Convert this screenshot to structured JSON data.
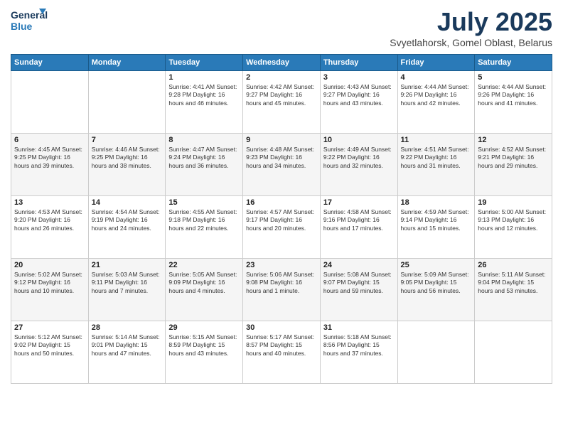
{
  "header": {
    "logo_line1": "General",
    "logo_line2": "Blue",
    "title": "July 2025",
    "subtitle": "Svyetlahorsk, Gomel Oblast, Belarus"
  },
  "weekdays": [
    "Sunday",
    "Monday",
    "Tuesday",
    "Wednesday",
    "Thursday",
    "Friday",
    "Saturday"
  ],
  "weeks": [
    [
      {
        "day": "",
        "info": ""
      },
      {
        "day": "",
        "info": ""
      },
      {
        "day": "1",
        "info": "Sunrise: 4:41 AM\nSunset: 9:28 PM\nDaylight: 16 hours and 46 minutes."
      },
      {
        "day": "2",
        "info": "Sunrise: 4:42 AM\nSunset: 9:27 PM\nDaylight: 16 hours and 45 minutes."
      },
      {
        "day": "3",
        "info": "Sunrise: 4:43 AM\nSunset: 9:27 PM\nDaylight: 16 hours and 43 minutes."
      },
      {
        "day": "4",
        "info": "Sunrise: 4:44 AM\nSunset: 9:26 PM\nDaylight: 16 hours and 42 minutes."
      },
      {
        "day": "5",
        "info": "Sunrise: 4:44 AM\nSunset: 9:26 PM\nDaylight: 16 hours and 41 minutes."
      }
    ],
    [
      {
        "day": "6",
        "info": "Sunrise: 4:45 AM\nSunset: 9:25 PM\nDaylight: 16 hours and 39 minutes."
      },
      {
        "day": "7",
        "info": "Sunrise: 4:46 AM\nSunset: 9:25 PM\nDaylight: 16 hours and 38 minutes."
      },
      {
        "day": "8",
        "info": "Sunrise: 4:47 AM\nSunset: 9:24 PM\nDaylight: 16 hours and 36 minutes."
      },
      {
        "day": "9",
        "info": "Sunrise: 4:48 AM\nSunset: 9:23 PM\nDaylight: 16 hours and 34 minutes."
      },
      {
        "day": "10",
        "info": "Sunrise: 4:49 AM\nSunset: 9:22 PM\nDaylight: 16 hours and 32 minutes."
      },
      {
        "day": "11",
        "info": "Sunrise: 4:51 AM\nSunset: 9:22 PM\nDaylight: 16 hours and 31 minutes."
      },
      {
        "day": "12",
        "info": "Sunrise: 4:52 AM\nSunset: 9:21 PM\nDaylight: 16 hours and 29 minutes."
      }
    ],
    [
      {
        "day": "13",
        "info": "Sunrise: 4:53 AM\nSunset: 9:20 PM\nDaylight: 16 hours and 26 minutes."
      },
      {
        "day": "14",
        "info": "Sunrise: 4:54 AM\nSunset: 9:19 PM\nDaylight: 16 hours and 24 minutes."
      },
      {
        "day": "15",
        "info": "Sunrise: 4:55 AM\nSunset: 9:18 PM\nDaylight: 16 hours and 22 minutes."
      },
      {
        "day": "16",
        "info": "Sunrise: 4:57 AM\nSunset: 9:17 PM\nDaylight: 16 hours and 20 minutes."
      },
      {
        "day": "17",
        "info": "Sunrise: 4:58 AM\nSunset: 9:16 PM\nDaylight: 16 hours and 17 minutes."
      },
      {
        "day": "18",
        "info": "Sunrise: 4:59 AM\nSunset: 9:14 PM\nDaylight: 16 hours and 15 minutes."
      },
      {
        "day": "19",
        "info": "Sunrise: 5:00 AM\nSunset: 9:13 PM\nDaylight: 16 hours and 12 minutes."
      }
    ],
    [
      {
        "day": "20",
        "info": "Sunrise: 5:02 AM\nSunset: 9:12 PM\nDaylight: 16 hours and 10 minutes."
      },
      {
        "day": "21",
        "info": "Sunrise: 5:03 AM\nSunset: 9:11 PM\nDaylight: 16 hours and 7 minutes."
      },
      {
        "day": "22",
        "info": "Sunrise: 5:05 AM\nSunset: 9:09 PM\nDaylight: 16 hours and 4 minutes."
      },
      {
        "day": "23",
        "info": "Sunrise: 5:06 AM\nSunset: 9:08 PM\nDaylight: 16 hours and 1 minute."
      },
      {
        "day": "24",
        "info": "Sunrise: 5:08 AM\nSunset: 9:07 PM\nDaylight: 15 hours and 59 minutes."
      },
      {
        "day": "25",
        "info": "Sunrise: 5:09 AM\nSunset: 9:05 PM\nDaylight: 15 hours and 56 minutes."
      },
      {
        "day": "26",
        "info": "Sunrise: 5:11 AM\nSunset: 9:04 PM\nDaylight: 15 hours and 53 minutes."
      }
    ],
    [
      {
        "day": "27",
        "info": "Sunrise: 5:12 AM\nSunset: 9:02 PM\nDaylight: 15 hours and 50 minutes."
      },
      {
        "day": "28",
        "info": "Sunrise: 5:14 AM\nSunset: 9:01 PM\nDaylight: 15 hours and 47 minutes."
      },
      {
        "day": "29",
        "info": "Sunrise: 5:15 AM\nSunset: 8:59 PM\nDaylight: 15 hours and 43 minutes."
      },
      {
        "day": "30",
        "info": "Sunrise: 5:17 AM\nSunset: 8:57 PM\nDaylight: 15 hours and 40 minutes."
      },
      {
        "day": "31",
        "info": "Sunrise: 5:18 AM\nSunset: 8:56 PM\nDaylight: 15 hours and 37 minutes."
      },
      {
        "day": "",
        "info": ""
      },
      {
        "day": "",
        "info": ""
      }
    ]
  ]
}
